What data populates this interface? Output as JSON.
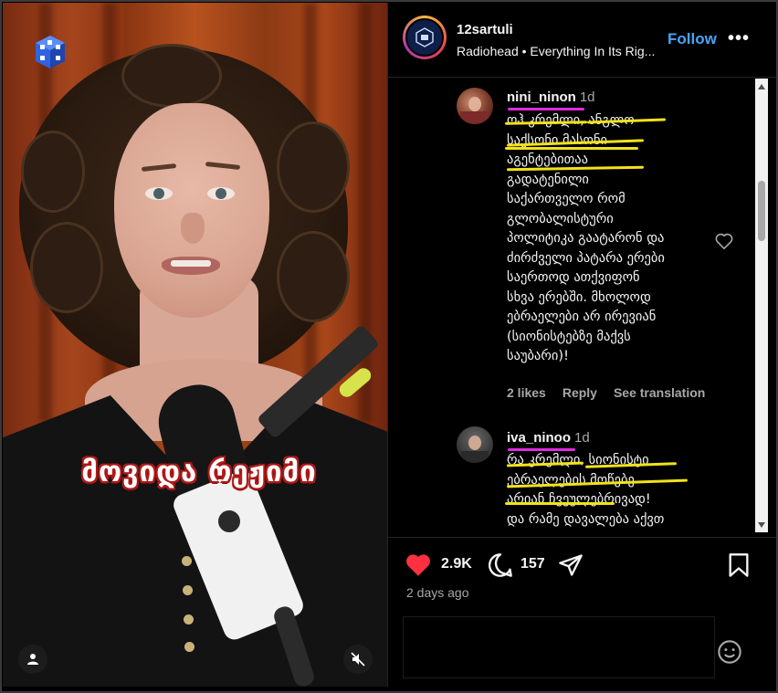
{
  "video": {
    "caption": "მოვიდა რეჟიმი",
    "logo_icon": "cube-logo-icon",
    "account_icon": "user-icon",
    "mute_icon": "speaker-muted-icon"
  },
  "post": {
    "username": "12sartuli",
    "audio": "Radiohead • Everything In Its Rig...",
    "follow_label": "Follow",
    "more_label": "•••"
  },
  "comments": [
    {
      "username": "nini_ninon",
      "time": "1d",
      "text": "ოჰ კრემლი, ანგლო-\nსაქსონი მასონი\nაგენტებითაა\nგადატენილი\nსაქართველო რომ\nგლობალისტური\nპოლიტიკა გაატარონ და\nძირძველი პატარა ერები\nსაერთოდ ათქვიფონ\nსხვა ერებში. მხოლოდ\nებრაელები არ ირევიან\n(სიონისტებზე მაქვს\nსაუბარი)!",
      "likes": "2 likes",
      "reply": "Reply",
      "translate": "See translation"
    },
    {
      "username": "iva_ninoo",
      "time": "1d",
      "text": "რა კრემლი, სიონისტი\nებრაელების მოწებე\nარიან ჩვეულებრივად!\nდა რამე დავალება აქვთ"
    }
  ],
  "stats": {
    "likes": "2.9K",
    "comments": "157",
    "date": "2 days ago"
  },
  "colors": {
    "accent": "#4aa3f7",
    "like_red": "#ff3040",
    "highlight_yellow": "#f1e21b",
    "highlight_magenta": "#e22ae0"
  }
}
